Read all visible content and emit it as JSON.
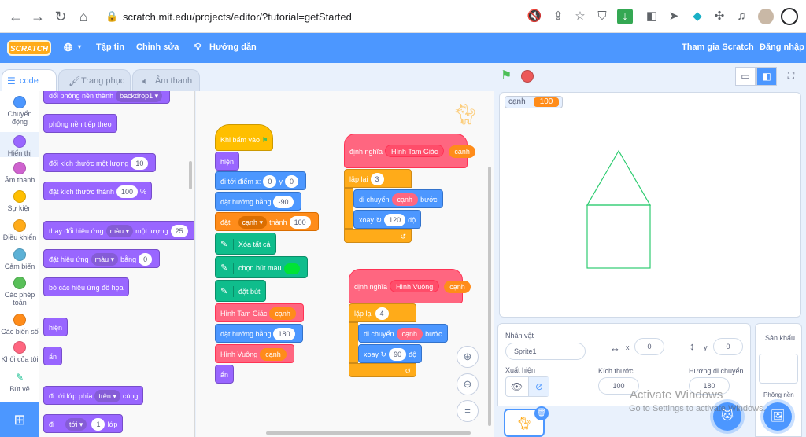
{
  "browser": {
    "url": "scratch.mit.edu/projects/editor/?tutorial=getStarted",
    "back_icon": "arrow-left-icon",
    "forward_icon": "arrow-right-icon"
  },
  "menubar": {
    "logo": "SCRATCH",
    "file": "Tập tin",
    "edit": "Chỉnh sửa",
    "tutorials": "Hướng dẫn",
    "join": "Tham gia Scratch",
    "signin": "Đăng nhập"
  },
  "tabs": {
    "code": "code",
    "costumes": "Trang phục",
    "sounds": "Âm thanh"
  },
  "categories": [
    {
      "label": "Chuyển động",
      "color": "#4c97ff"
    },
    {
      "label": "Hiển thị",
      "color": "#9966ff"
    },
    {
      "label": "Âm thanh",
      "color": "#cf63cf"
    },
    {
      "label": "Sự kiện",
      "color": "#ffbf00"
    },
    {
      "label": "Điều khiển",
      "color": "#ffab19"
    },
    {
      "label": "Cảm biến",
      "color": "#5cb1d6"
    },
    {
      "label": "Các phép toán",
      "color": "#59c059"
    },
    {
      "label": "Các biến số",
      "color": "#ff8c1a"
    },
    {
      "label": "Khối của tôi",
      "color": "#ff6680"
    },
    {
      "label": "Bút vẽ",
      "color": "#0fbd8c"
    }
  ],
  "palette": {
    "switch_backdrop": "đổi phông nền thành",
    "switch_backdrop_dd": "backdrop1",
    "next_backdrop": "phông nền tiếp theo",
    "change_size": "đổi kích thước một lượng",
    "change_size_val": "10",
    "set_size": "đặt kích thước thành",
    "set_size_val": "100",
    "set_size_unit": "%",
    "change_effect": "thay đổi hiệu ứng",
    "change_effect_dd": "màu",
    "change_effect_mid": "một lượng",
    "change_effect_val": "25",
    "set_effect": "đặt hiệu ứng",
    "set_effect_dd": "màu",
    "set_effect_mid": "bằng",
    "set_effect_val": "0",
    "clear_effects": "bỏ các hiệu ứng đồ họa",
    "show": "hiện",
    "hide": "ẩn",
    "goto_layer": "đi tới lớp phía",
    "goto_layer_dd": "trên",
    "goto_layer_end": "cùng",
    "go_layers": "đi",
    "go_layers_dd": "tới",
    "go_layers_val": "1",
    "go_layers_end": "lớp"
  },
  "script1": {
    "when_flag": "Khi bấm vào",
    "show": "hiện",
    "goto": "đi tới điểm x:",
    "goto_x": "0",
    "goto_y_label": "y",
    "goto_y": "0",
    "point": "đặt hướng bằng",
    "point_val": "-90",
    "set_var": "đặt",
    "set_var_dd": "cạnh",
    "set_var_to": "thành",
    "set_var_val": "100",
    "erase_all": "Xóa tất cả",
    "set_pen_color": "chọn bút màu",
    "pen_down": "đặt bút",
    "call_triangle": "Hình Tam Giác",
    "call_triangle_arg": "cạnh",
    "point2": "đặt hướng bằng",
    "point2_val": "180",
    "call_square": "Hình Vuông",
    "call_square_arg": "cạnh",
    "hide": "ẩn"
  },
  "script2": {
    "define": "định nghĩa",
    "name": "Hình Tam Giác",
    "param": "cạnh",
    "repeat": "lặp lại",
    "repeat_val": "3",
    "move": "di chuyển",
    "move_arg": "cạnh",
    "move_unit": "bước",
    "turn": "xoay",
    "turn_val": "120",
    "turn_unit": "độ"
  },
  "script3": {
    "define": "định nghĩa",
    "name": "Hình Vuông",
    "param": "cạnh",
    "repeat": "lặp lại",
    "repeat_val": "4",
    "move": "di chuyển",
    "move_arg": "cạnh",
    "move_unit": "bước",
    "turn": "xoay",
    "turn_val": "90",
    "turn_unit": "độ"
  },
  "stage": {
    "monitor_label": "cạnh",
    "monitor_value": "100",
    "line_color": "#2ecc71"
  },
  "sprite_info": {
    "sprite_label": "Nhân vật",
    "sprite_name": "Sprite1",
    "x_label": "x",
    "x_val": "0",
    "y_label": "y",
    "y_val": "0",
    "show_label": "Xuất hiện",
    "size_label": "Kích thước",
    "size_val": "100",
    "direction_label": "Hướng di chuyển",
    "direction_val": "180"
  },
  "stage_pane": {
    "title": "Sân khấu",
    "backdrops": "Phông nền"
  },
  "watermark": {
    "line1": "Activate Windows",
    "line2": "Go to Settings to activate Windows."
  }
}
